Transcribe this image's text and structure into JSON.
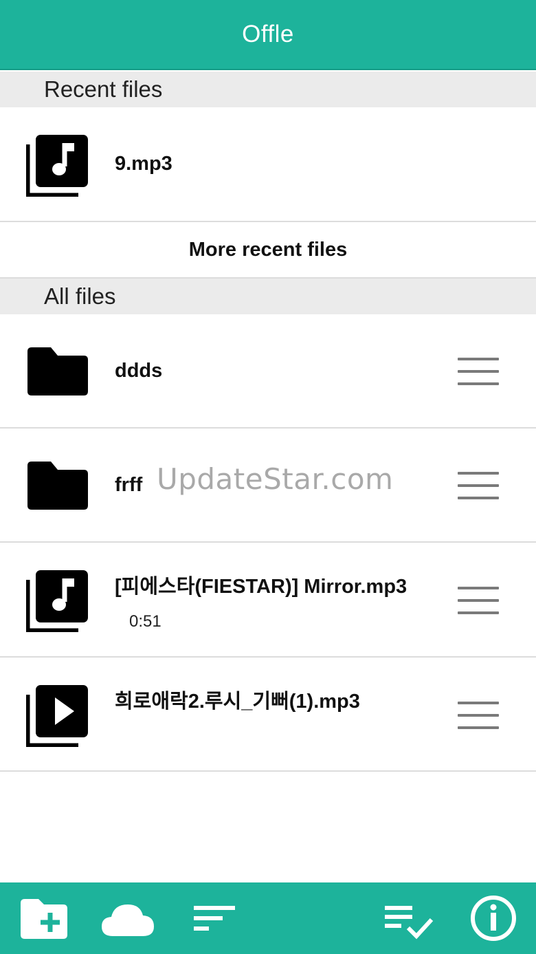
{
  "app": {
    "title": "Offle"
  },
  "recent": {
    "header": "Recent files",
    "items": [
      {
        "name": "9.mp3",
        "icon": "music-library-icon"
      }
    ],
    "more_label": "More recent files"
  },
  "all": {
    "header": "All files",
    "items": [
      {
        "name": "ddds",
        "icon": "folder-icon",
        "duration": ""
      },
      {
        "name": "frff",
        "icon": "folder-icon",
        "duration": ""
      },
      {
        "name": "[피에스타(FIESTAR)] Mirror.mp3",
        "icon": "music-library-icon",
        "duration": "0:51"
      },
      {
        "name": "희로애락2.루시_기뻐(1).mp3",
        "icon": "video-library-icon",
        "duration": ""
      }
    ]
  },
  "watermark": "UpdateStar.com",
  "toolbar": {
    "buttons": [
      "add-folder-icon",
      "cloud-icon",
      "sort-icon",
      "checklist-icon",
      "info-icon"
    ]
  },
  "colors": {
    "accent": "#1db39b",
    "section_bg": "#ebebeb",
    "divider": "#dcdcdc"
  }
}
